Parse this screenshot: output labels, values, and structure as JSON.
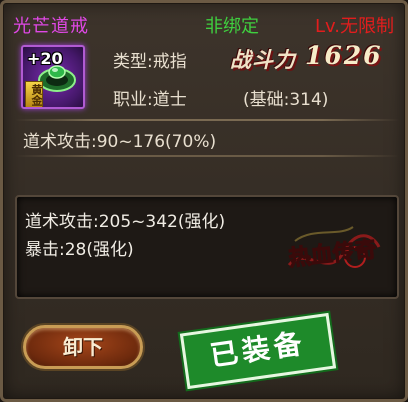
{
  "item": {
    "name": "光芒道戒",
    "bind_state": "非绑定",
    "level_requirement": "Lv.无限制",
    "enhance_level": "+20",
    "rarity_tag": "黄金",
    "type_label": "类型:",
    "type_value": "戒指",
    "class_label": "职业:",
    "class_value": "道士",
    "combat_power_label": "战斗力",
    "combat_power_value": "1626",
    "base_value_text": "(基础:314)",
    "base_attack_text": "道术攻击:90~176(70%)"
  },
  "enhancement": {
    "lines": [
      "道术攻击:205~342(强化)",
      "暴击:28(强化)"
    ],
    "logo_text": "热血传奇"
  },
  "actions": {
    "unequip_label": "卸下",
    "equipped_label": "已装备"
  },
  "colors": {
    "item_name": "#e048e6",
    "bind_state": "#3fcf3f",
    "level_requirement": "#e21d1d"
  },
  "icons": {
    "item_icon": "jade-ring-icon",
    "logo": "game-logo"
  }
}
